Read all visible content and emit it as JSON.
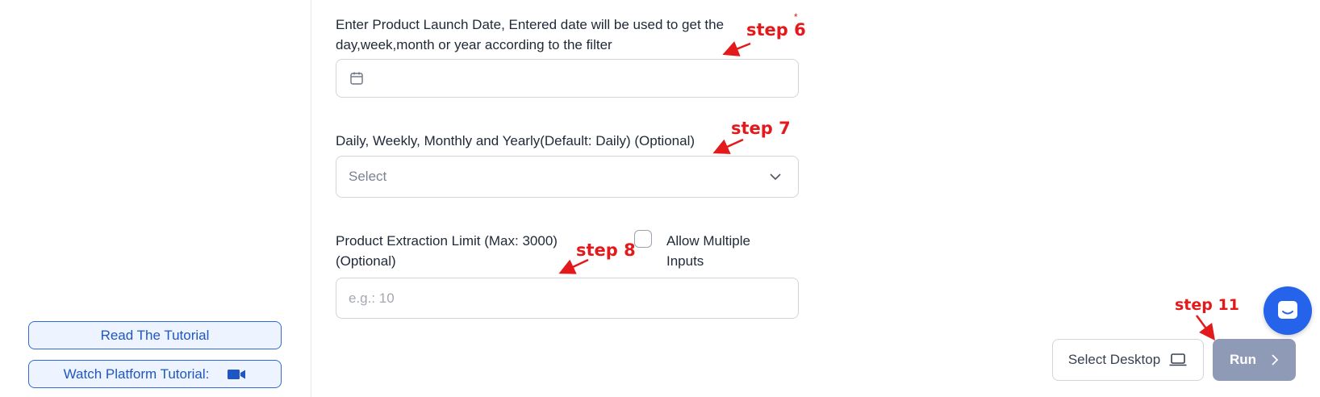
{
  "sidebar": {
    "read_tutorial": "Read The Tutorial",
    "watch_tutorial": "Watch Platform Tutorial:"
  },
  "form": {
    "launch_date": {
      "label_line1": "Enter Product Launch Date, Entered date will be used to get the",
      "label_line2": "day,week,month or year according to the filter",
      "value": ""
    },
    "frequency": {
      "label": "Daily, Weekly, Monthly and Yearly(Default: Daily) (Optional)",
      "selected": "Select"
    },
    "extraction_limit": {
      "label_line1": "Product Extraction Limit (Max: 3000)",
      "label_line2": "(Optional)",
      "placeholder": "e.g.: 10"
    },
    "allow_multiple": {
      "label_line1": "Allow Multiple",
      "label_line2": "Inputs",
      "checked": false
    }
  },
  "annotations": {
    "step6": "step 6",
    "step7": "step 7",
    "step8": "step 8",
    "step11": "step 11"
  },
  "footer": {
    "select_desktop": "Select Desktop",
    "run": "Run"
  },
  "icons": {
    "date": "calendar-icon",
    "select": "chevron-down-icon",
    "desktop": "laptop-icon",
    "run": "chevron-right-icon",
    "chat": "chat-icon",
    "video": "video-camera-icon"
  },
  "colors": {
    "accent": "#2563eb",
    "annotation": "#e3191b",
    "run_button": "#8f9ab7"
  }
}
